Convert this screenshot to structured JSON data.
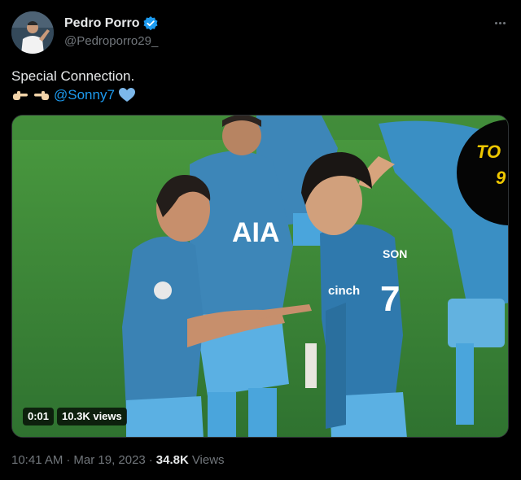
{
  "user": {
    "display_name": "Pedro Porro",
    "handle": "@Pedroporro29_"
  },
  "tweet": {
    "text_line1": "Special Connection.",
    "mention": "@Sonny7",
    "emojis": [
      "pointing-right-hand",
      "pointing-left-hand",
      "blue-heart"
    ]
  },
  "video": {
    "elapsed": "0:01",
    "views_badge": "10.3K views",
    "overlay_text_1": "TO",
    "overlay_text_2": "9",
    "shirt_sponsor_left": "AIA",
    "shirt_sponsor_right": "cinch",
    "shirt_name": "SON",
    "shirt_number": "7"
  },
  "footer": {
    "time": "10:41 AM",
    "separator": "·",
    "date": "Mar 19, 2023",
    "views_count": "34.8K",
    "views_label": "Views"
  },
  "colors": {
    "background": "#000000",
    "text": "#e7e9ea",
    "muted": "#71767b",
    "accent": "#1d9bf0",
    "pitch": "#3f8a3a",
    "kit": "#3d86b8"
  }
}
